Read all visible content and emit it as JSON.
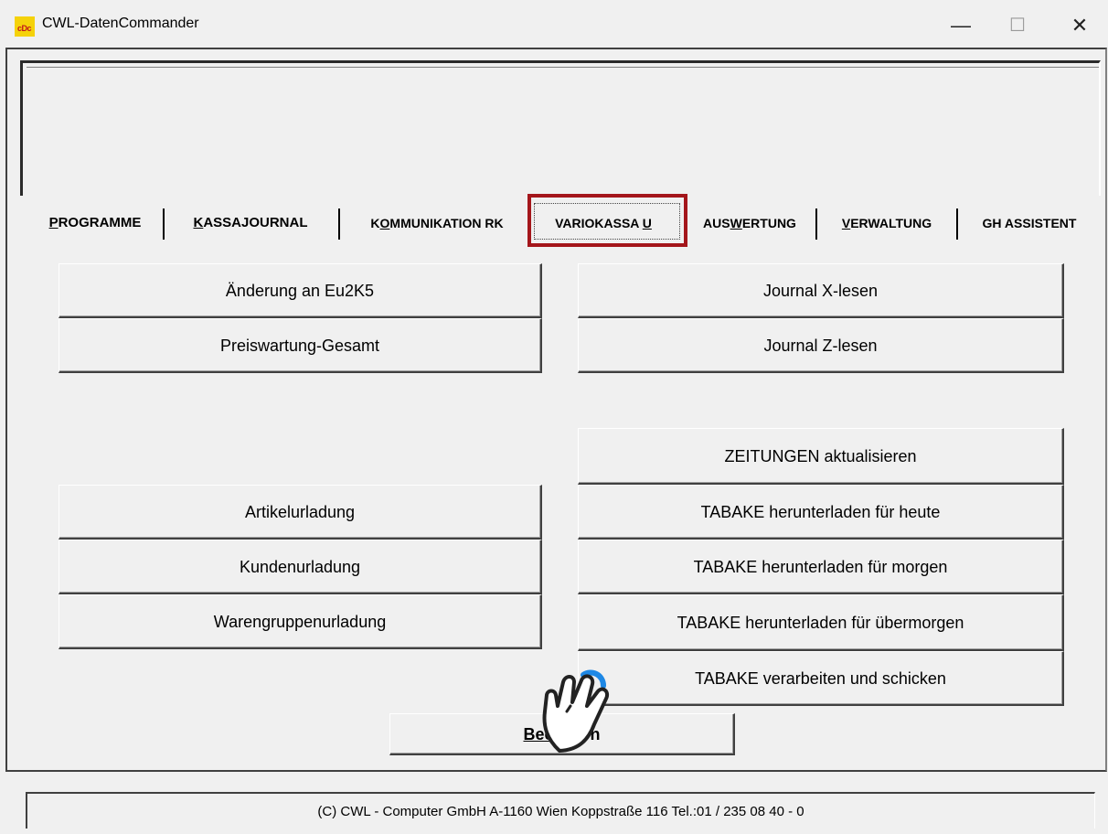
{
  "window": {
    "title": "CWL-DatenCommander",
    "icon": "cwl-app-icon",
    "icon_text": "cDc",
    "controls": {
      "minimize": "—",
      "maximize": "☐",
      "close": "✕"
    }
  },
  "tabs": [
    {
      "pre": "",
      "u": "P",
      "post": "ROGRAMME"
    },
    {
      "pre": "",
      "u": "K",
      "post": "ASSAJOURNAL"
    },
    {
      "pre": "K",
      "u": "O",
      "post": "MMUNIKATION RK"
    },
    {
      "pre": "VARIOKASSA ",
      "u": "U",
      "post": ""
    },
    {
      "pre": "AUS",
      "u": "W",
      "post": "ERTUNG"
    },
    {
      "pre": "",
      "u": "V",
      "post": "ERWALTUNG"
    },
    {
      "pre": "GH ASSISTENT",
      "u": "",
      "post": ""
    }
  ],
  "active_tab_index": 3,
  "highlight_color": "#a4161b",
  "left_buttons": [
    "Änderung an Eu2K5",
    "Preiswartung-Gesamt",
    "Artikelurladung",
    "Kundenurladung",
    "Warengruppenurladung"
  ],
  "right_buttons": [
    "Journal X-lesen",
    "Journal Z-lesen",
    "ZEITUNGEN aktualisieren",
    "TABAKE herunterladen für heute",
    "TABAKE herunterladen für morgen",
    "TABAKE herunterladen für übermorgen",
    "TABAKE verarbeiten und schicken"
  ],
  "exit_button": {
    "u": "Bee",
    "post": "n"
  },
  "cursor_icon": "hand-pointer-icon",
  "status": "(C) CWL - Computer GmbH  A-1160 Wien  Koppstraße 116  Tel.:01 / 235 08 40 - 0"
}
